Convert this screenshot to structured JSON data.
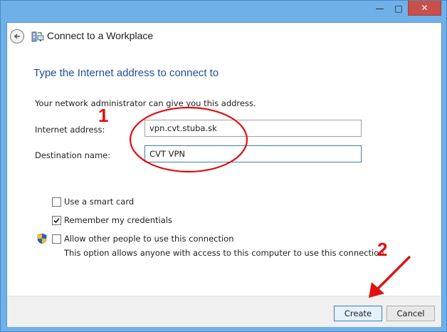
{
  "window": {
    "minimize_glyph": "—",
    "maximize_glyph": "□",
    "close_glyph": "✕"
  },
  "wizard": {
    "title": "Connect to a Workplace",
    "heading": "Type the Internet address to connect to",
    "description": "Your network administrator can give you this address."
  },
  "fields": {
    "internet_address_label": "Internet address:",
    "internet_address_value": "vpn.cvt.stuba.sk",
    "destination_name_label": "Destination name:",
    "destination_name_value": "CVT VPN"
  },
  "options": {
    "smart_card_label": "Use a smart card",
    "smart_card_checked": false,
    "remember_label": "Remember my credentials",
    "remember_checked": true,
    "allow_others_label": "Allow other people to use this connection",
    "allow_others_checked": false,
    "allow_others_note": "This option allows anyone with access to this computer to use this connection."
  },
  "buttons": {
    "create_label": "Create",
    "cancel_label": "Cancel"
  },
  "annotations": {
    "step1": "1",
    "step2": "2",
    "color": "#e01010"
  },
  "icons": {
    "back": "back-arrow-icon",
    "wizard": "workplace-network-icon",
    "shield": "uac-shield-icon"
  }
}
